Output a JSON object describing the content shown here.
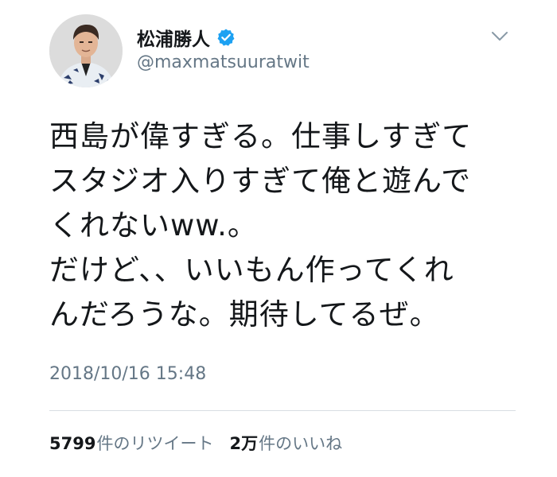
{
  "user": {
    "display_name": "松浦勝人",
    "handle": "@maxmatsuuratwit",
    "verified": true,
    "avatar": "profile-photo"
  },
  "tweet": {
    "lines": [
      "西島が偉すぎる。仕事しすぎて",
      "スタジオ入りすぎて俺と遊んで",
      "くれないww.。",
      "だけど、、いいもん作ってくれ",
      "んだろうな。期待してるぜ。"
    ],
    "timestamp": "2018/10/16 15:48"
  },
  "stats": {
    "retweets_count": "5799",
    "retweets_label": "件のリツイート",
    "likes_count": "2万",
    "likes_label": "件のいいね"
  },
  "icons": {
    "verified": "verified-badge-icon",
    "menu": "chevron-down-icon"
  },
  "colors": {
    "verified_blue": "#1da1f2",
    "text_primary": "#14171a",
    "text_secondary": "#657786",
    "divider": "#d8dee3"
  }
}
